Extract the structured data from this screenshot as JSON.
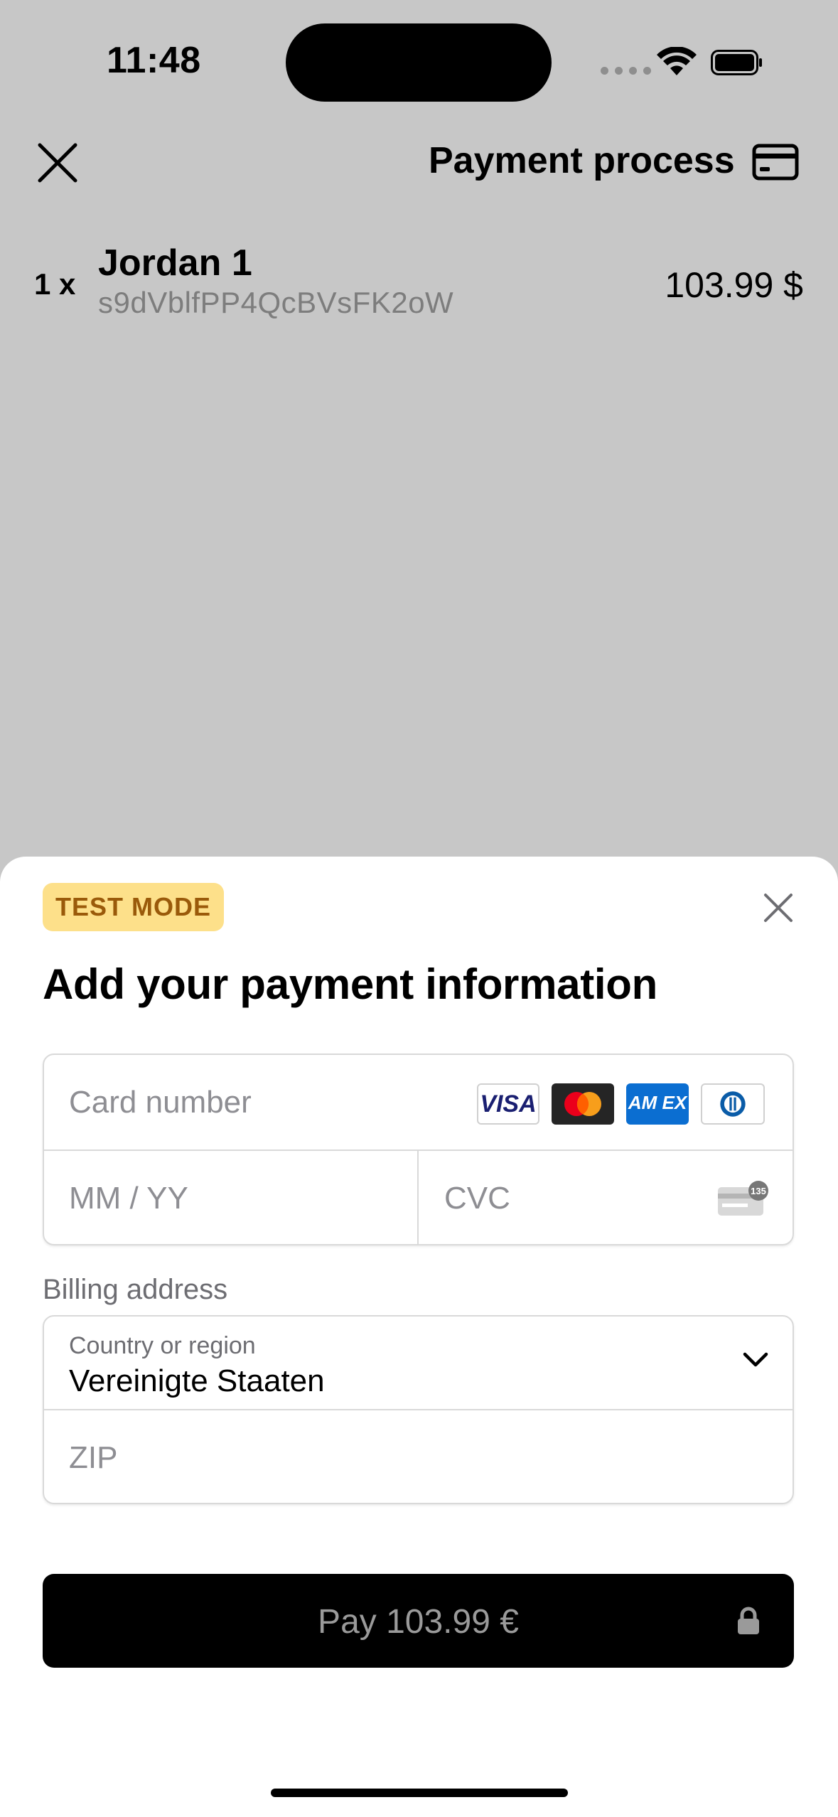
{
  "status_bar": {
    "time": "11:48"
  },
  "header": {
    "title": "Payment process"
  },
  "order_item": {
    "quantity": "1 x",
    "name": "Jordan 1",
    "id": "s9dVblfPP4QcBVsFK2oW",
    "price": "103.99 $"
  },
  "sheet": {
    "badge": "TEST MODE",
    "title": "Add your payment information",
    "card": {
      "number_placeholder": "Card number",
      "expiry_placeholder": "MM / YY",
      "cvc_placeholder": "CVC",
      "brands": [
        "visa",
        "mastercard",
        "amex",
        "diners"
      ],
      "visa_text": "VISA",
      "amex_text": "AM EX",
      "cvc_icon_text": "135"
    },
    "billing": {
      "label": "Billing address",
      "country_label": "Country or region",
      "country_value": "Vereinigte Staaten",
      "zip_placeholder": "ZIP"
    },
    "pay_button": "Pay 103.99 €"
  },
  "icons": [
    "close-icon",
    "credit-card-icon",
    "wifi-icon",
    "battery-icon",
    "chevron-down-icon",
    "lock-icon"
  ]
}
